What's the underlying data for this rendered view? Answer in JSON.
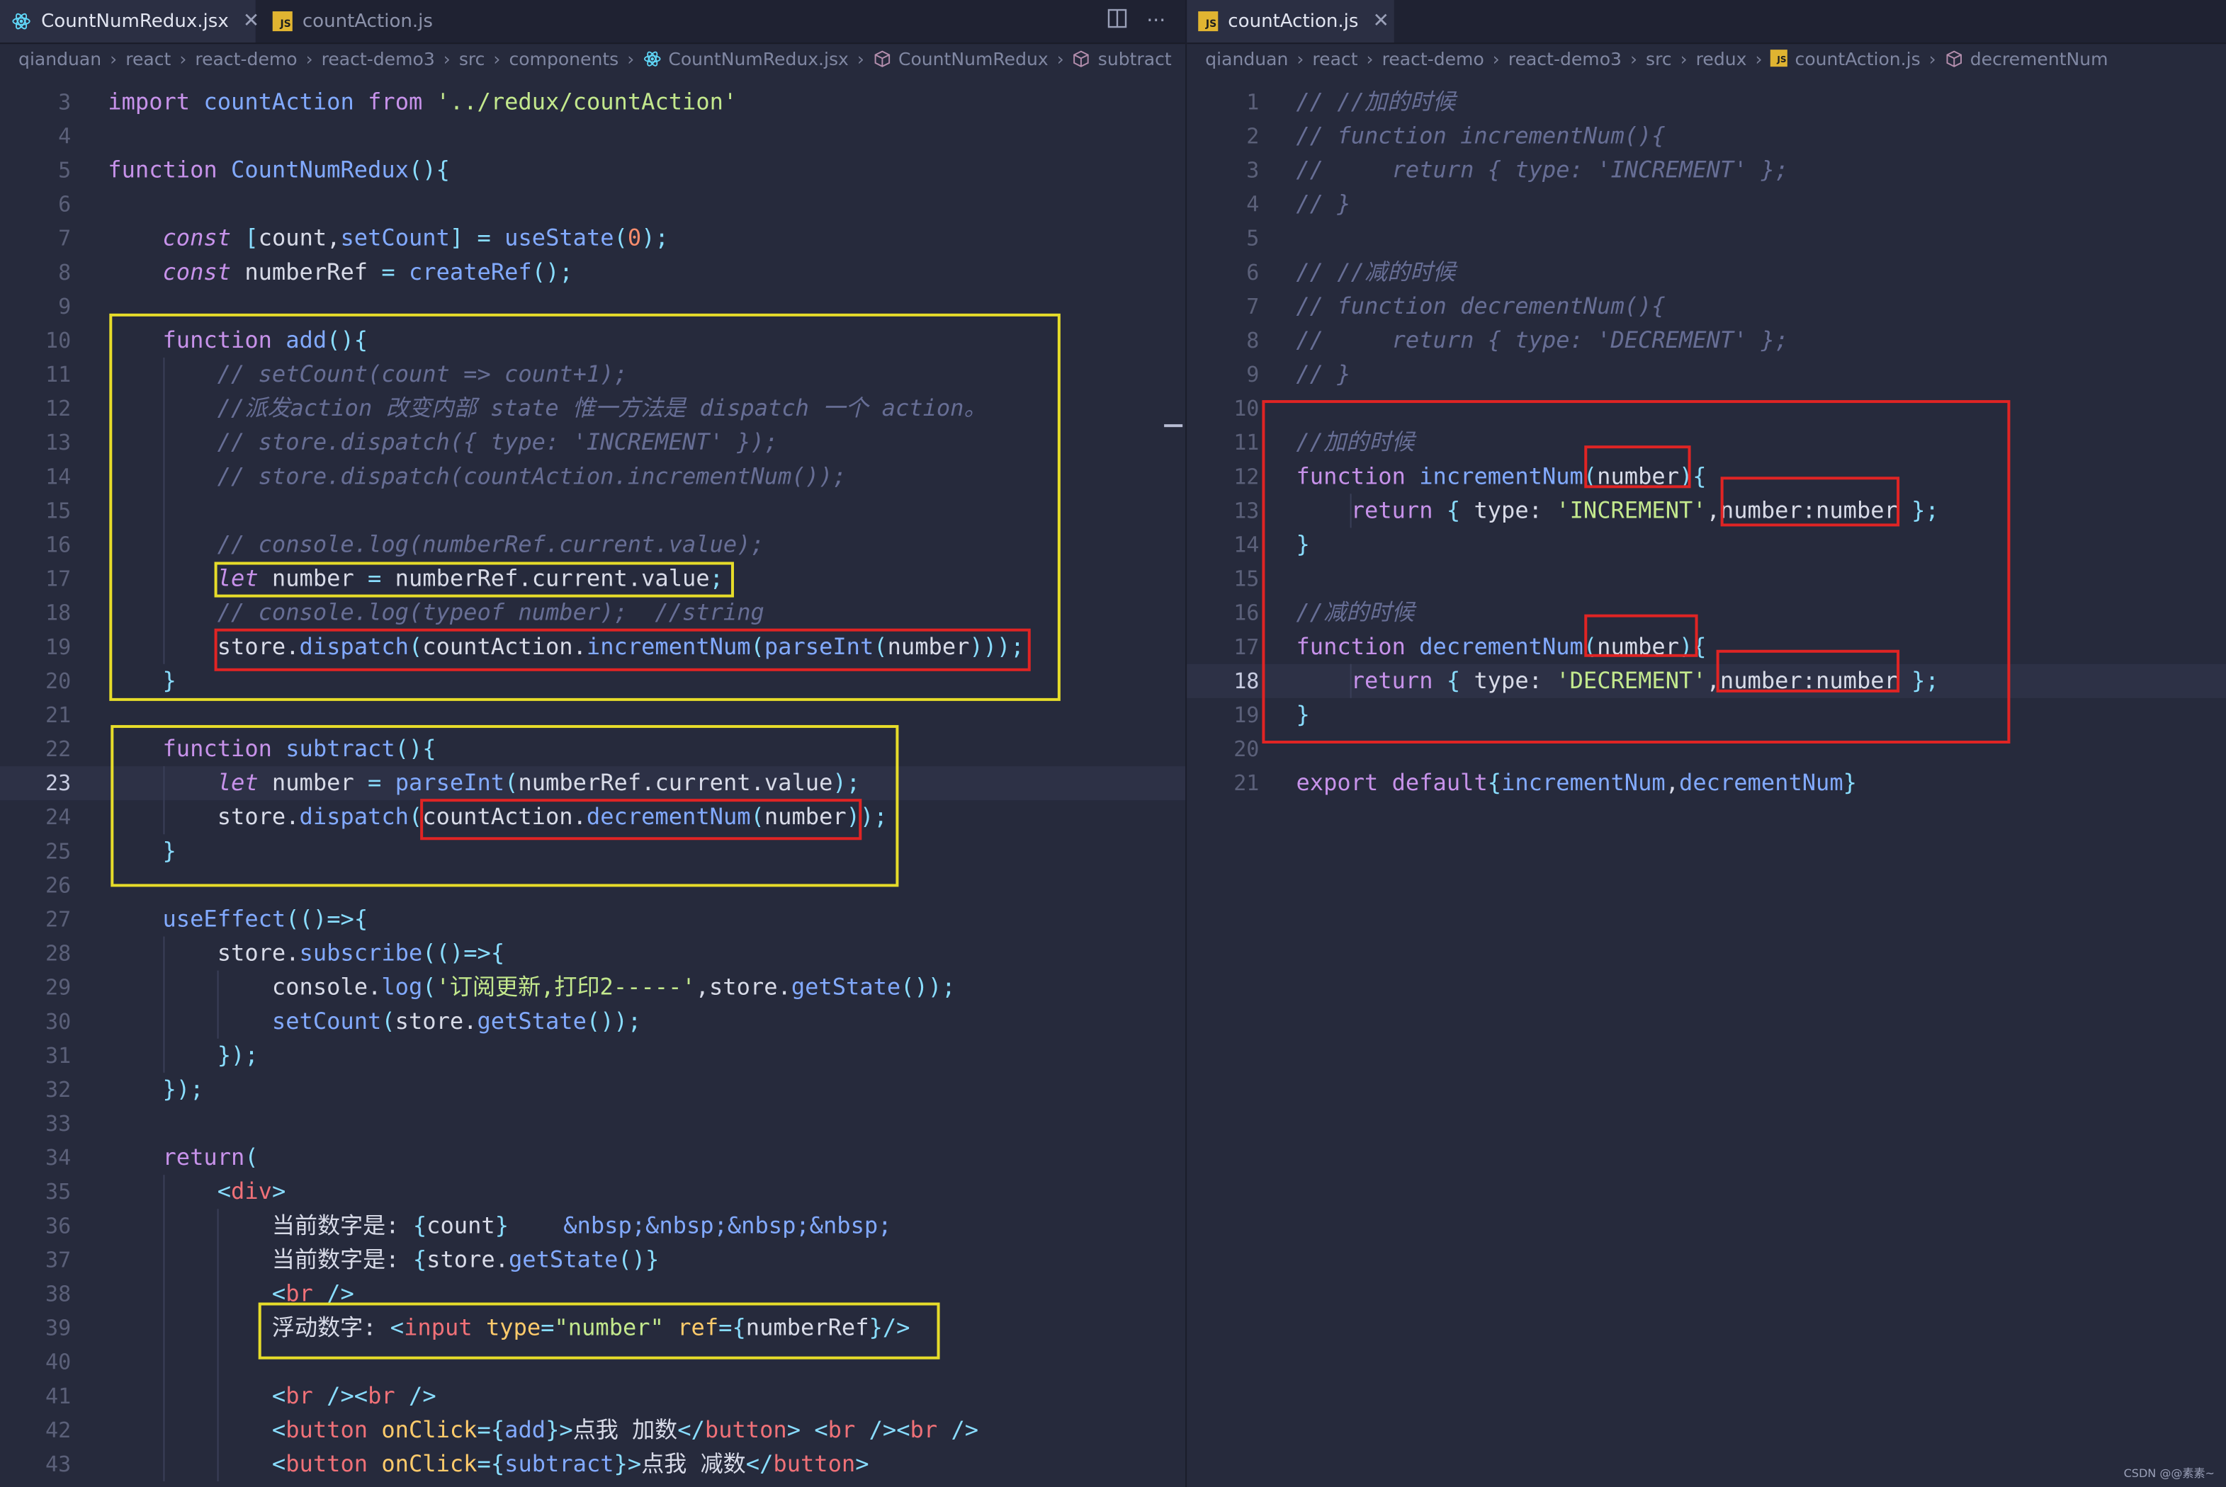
{
  "left": {
    "tabs": [
      {
        "label": "CountNumRedux.jsx",
        "icon": "react-icon",
        "active": true
      },
      {
        "label": "countAction.js",
        "icon": "js-file-icon",
        "active": false
      }
    ],
    "actions": {
      "split": "▯",
      "more": "···"
    },
    "breadcrumb": [
      "qianduan",
      "react",
      "react-demo",
      "react-demo3",
      "src",
      "components",
      "CountNumRedux.jsx",
      "CountNumRedux",
      "subtract"
    ],
    "lines": [
      {
        "n": "3",
        "t": "import countAction from '../redux/countAction'"
      },
      {
        "n": "4",
        "t": ""
      },
      {
        "n": "5",
        "t": "function CountNumRedux(){"
      },
      {
        "n": "6",
        "t": ""
      },
      {
        "n": "7",
        "t": "    const [count,setCount] = useState(0);"
      },
      {
        "n": "8",
        "t": "    const numberRef = createRef();"
      },
      {
        "n": "9",
        "t": ""
      },
      {
        "n": "10",
        "t": "    function add(){"
      },
      {
        "n": "11",
        "t": "        // setCount(count => count+1);"
      },
      {
        "n": "12",
        "t": "        //派发action 改变内部 state 惟一方法是 dispatch 一个 action。"
      },
      {
        "n": "13",
        "t": "        // store.dispatch({ type: 'INCREMENT' });"
      },
      {
        "n": "14",
        "t": "        // store.dispatch(countAction.incrementNum());"
      },
      {
        "n": "15",
        "t": ""
      },
      {
        "n": "16",
        "t": "        // console.log(numberRef.current.value);"
      },
      {
        "n": "17",
        "t": "        let number = numberRef.current.value;"
      },
      {
        "n": "18",
        "t": "        // console.log(typeof number);  //string"
      },
      {
        "n": "19",
        "t": "        store.dispatch(countAction.incrementNum(parseInt(number)));"
      },
      {
        "n": "20",
        "t": "    }"
      },
      {
        "n": "21",
        "t": ""
      },
      {
        "n": "22",
        "t": "    function subtract(){"
      },
      {
        "n": "23",
        "t": "        let number = parseInt(numberRef.current.value);"
      },
      {
        "n": "24",
        "t": "        store.dispatch(countAction.decrementNum(number));"
      },
      {
        "n": "25",
        "t": "    }"
      },
      {
        "n": "26",
        "t": ""
      },
      {
        "n": "27",
        "t": "    useEffect(()=>{"
      },
      {
        "n": "28",
        "t": "        store.subscribe(()=>{"
      },
      {
        "n": "29",
        "t": "            console.log('订阅更新,打印2-----',store.getState());"
      },
      {
        "n": "30",
        "t": "            setCount(store.getState());"
      },
      {
        "n": "31",
        "t": "        });"
      },
      {
        "n": "32",
        "t": "    });"
      },
      {
        "n": "33",
        "t": ""
      },
      {
        "n": "34",
        "t": "    return("
      },
      {
        "n": "35",
        "t": "        <div>"
      },
      {
        "n": "36",
        "t": "            当前数字是: {count}    &nbsp;&nbsp;&nbsp;&nbsp;"
      },
      {
        "n": "37",
        "t": "            当前数字是: {store.getState()}"
      },
      {
        "n": "38",
        "t": "            <br />"
      },
      {
        "n": "39",
        "t": "            浮动数字: <input type=\"number\" ref={numberRef}/>"
      },
      {
        "n": "40",
        "t": ""
      },
      {
        "n": "41",
        "t": "            <br /><br />"
      },
      {
        "n": "42",
        "t": "            <button onClick={add}>点我 加数</button> <br /><br />"
      },
      {
        "n": "43",
        "t": "            <button onClick={subtract}>点我 减数</button>"
      }
    ]
  },
  "right": {
    "tabs": [
      {
        "label": "countAction.js",
        "icon": "js-file-icon",
        "active": true
      }
    ],
    "breadcrumb": [
      "qianduan",
      "react",
      "react-demo",
      "react-demo3",
      "src",
      "redux",
      "countAction.js",
      "decrementNum"
    ],
    "lines": [
      {
        "n": "1",
        "t": "// //加的时候"
      },
      {
        "n": "2",
        "t": "// function incrementNum(){"
      },
      {
        "n": "3",
        "t": "//     return { type: 'INCREMENT' };"
      },
      {
        "n": "4",
        "t": "// }"
      },
      {
        "n": "5",
        "t": ""
      },
      {
        "n": "6",
        "t": "// //减的时候"
      },
      {
        "n": "7",
        "t": "// function decrementNum(){"
      },
      {
        "n": "8",
        "t": "//     return { type: 'DECREMENT' };"
      },
      {
        "n": "9",
        "t": "// }"
      },
      {
        "n": "10",
        "t": ""
      },
      {
        "n": "11",
        "t": "//加的时候"
      },
      {
        "n": "12",
        "t": "function incrementNum(number){"
      },
      {
        "n": "13",
        "t": "    return { type: 'INCREMENT',number:number };"
      },
      {
        "n": "14",
        "t": "}"
      },
      {
        "n": "15",
        "t": ""
      },
      {
        "n": "16",
        "t": "//减的时候"
      },
      {
        "n": "17",
        "t": "function decrementNum(number){"
      },
      {
        "n": "18",
        "t": "    return { type: 'DECREMENT',number:number };"
      },
      {
        "n": "19",
        "t": "}"
      },
      {
        "n": "20",
        "t": ""
      },
      {
        "n": "21",
        "t": "export default{incrementNum,decrementNum}"
      }
    ]
  },
  "watermark": "CSDN @@素素~"
}
